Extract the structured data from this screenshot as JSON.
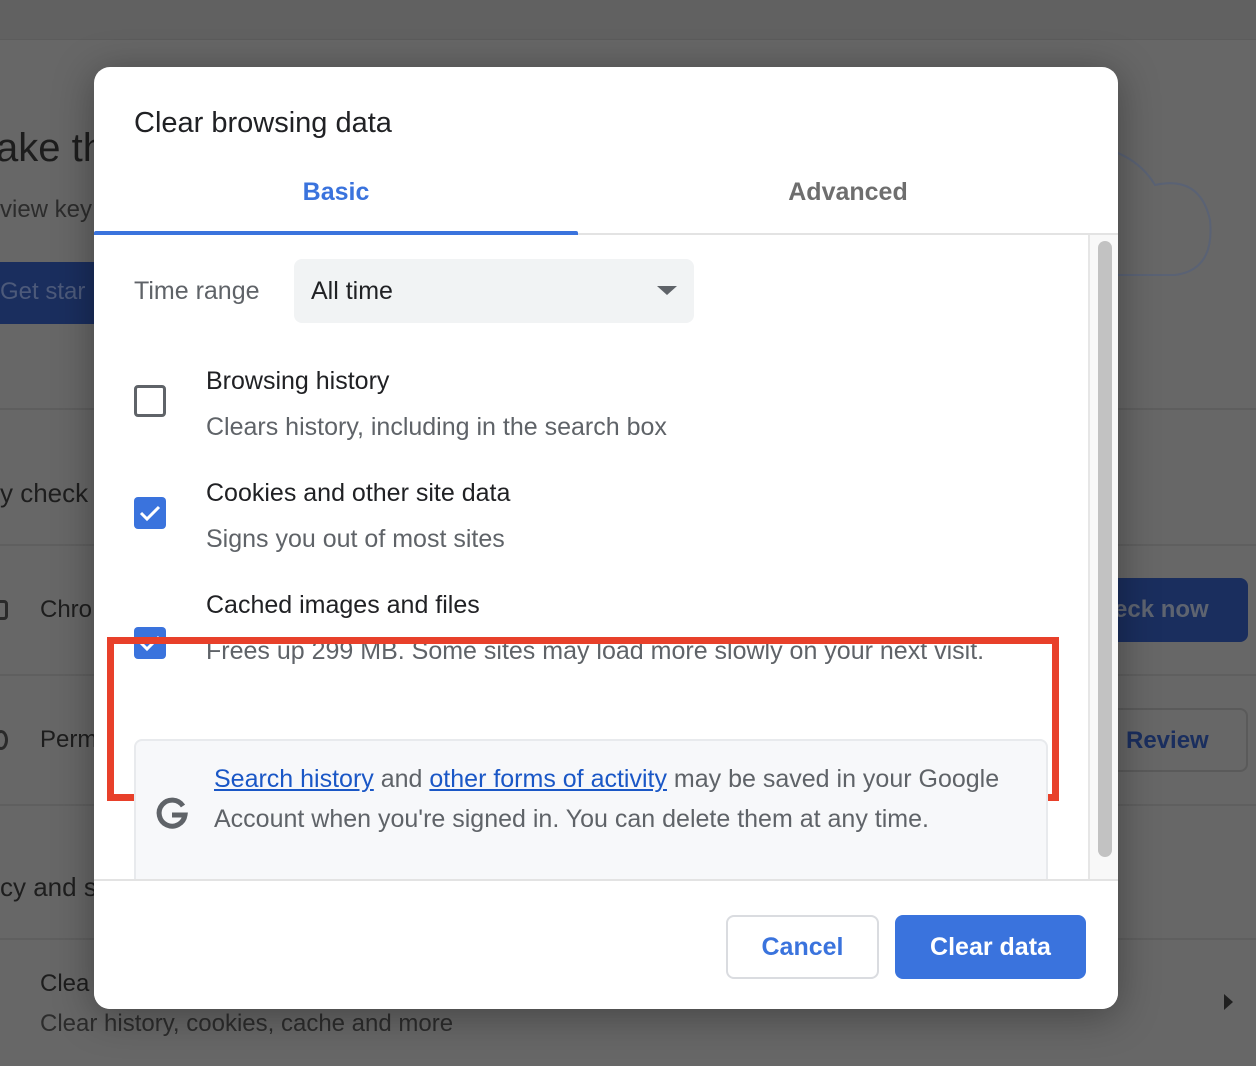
{
  "background": {
    "hero_title_fragment": "ake th",
    "hero_subtitle_fragment": "view key",
    "get_started_fragment": "Get star",
    "safety_check_fragment": "y check",
    "chrome_row_fragment": "Chro",
    "check_now_fragment": "eck now",
    "permissions_row_fragment": "Perm",
    "review_button": "Review",
    "privacy_section_fragment": "cy and s",
    "clear_row_title_fragment": "Clea",
    "clear_row_subtitle": "Clear history, cookies, cache and more"
  },
  "dialog": {
    "title": "Clear browsing data",
    "tabs": [
      {
        "label": "Basic",
        "active": true
      },
      {
        "label": "Advanced",
        "active": false
      }
    ],
    "time_range": {
      "label": "Time range",
      "selected": "All time"
    },
    "options": [
      {
        "title": "Browsing history",
        "description": "Clears history, including in the search box",
        "checked": false
      },
      {
        "title": "Cookies and other site data",
        "description": "Signs you out of most sites",
        "checked": true
      },
      {
        "title": "Cached images and files",
        "description": "Frees up 299 MB. Some sites may load more slowly on your next visit.",
        "checked": true,
        "highlighted": true
      }
    ],
    "info": {
      "link1": "Search history",
      "text1": " and ",
      "link2": "other forms of activity",
      "text2": " may be saved in your Google Account when you're signed in. You can delete them at any time."
    },
    "buttons": {
      "cancel": "Cancel",
      "clear": "Clear data"
    }
  },
  "colors": {
    "accent": "#3a73dd",
    "highlight": "#e8402a",
    "overlay": "#676767"
  }
}
